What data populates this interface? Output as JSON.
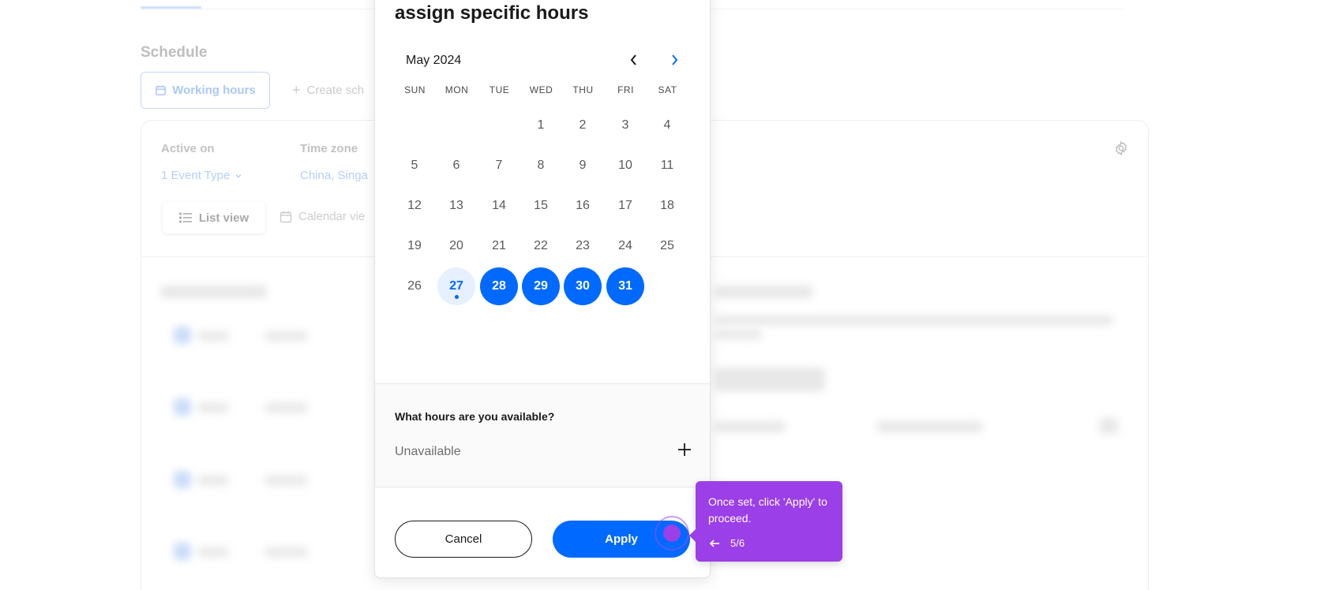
{
  "background": {
    "section_title": "Schedule",
    "working_hours_label": "Working hours",
    "create_schedule_label": "Create sch",
    "active_on_label": "Active on",
    "active_on_value": "1 Event Type",
    "timezone_label": "Time zone",
    "timezone_value": "China, Singa",
    "list_view_label": "List view",
    "calendar_view_label": "Calendar vie"
  },
  "modal": {
    "title": "assign specific hours",
    "month": "May 2024",
    "weekdays": [
      "SUN",
      "MON",
      "TUE",
      "WED",
      "THU",
      "FRI",
      "SAT"
    ],
    "weeks": [
      [
        "",
        "",
        "",
        "1",
        "2",
        "3",
        "4"
      ],
      [
        "5",
        "6",
        "7",
        "8",
        "9",
        "10",
        "11"
      ],
      [
        "12",
        "13",
        "14",
        "15",
        "16",
        "17",
        "18"
      ],
      [
        "19",
        "20",
        "21",
        "22",
        "23",
        "24",
        "25"
      ],
      [
        "26",
        "27",
        "28",
        "29",
        "30",
        "31",
        ""
      ]
    ],
    "today": "27",
    "selected_days": [
      "28",
      "29",
      "30",
      "31"
    ],
    "hours_question": "What hours are you available?",
    "hours_status": "Unavailable",
    "cancel_label": "Cancel",
    "apply_label": "Apply"
  },
  "tooltip": {
    "text": "Once set, click 'Apply' to proceed.",
    "step": "5/6"
  },
  "colors": {
    "accent": "#0069ff",
    "tooltip": "#9b3fe8"
  }
}
